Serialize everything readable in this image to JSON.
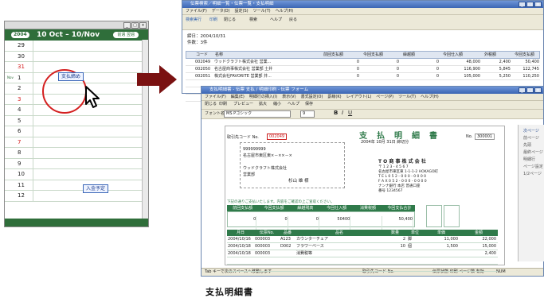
{
  "calendar": {
    "year_badge": "2004",
    "range": "10 Oct – 10/Nov",
    "nav_label": "前週 翌週",
    "rows": [
      {
        "num": "29",
        "sub": "",
        "red": false
      },
      {
        "num": "30",
        "sub": "",
        "red": false
      },
      {
        "num": "31",
        "sub": "",
        "red": true
      },
      {
        "num": "1",
        "sub": "Nov",
        "red": false
      },
      {
        "num": "2",
        "sub": "",
        "red": false
      },
      {
        "num": "3",
        "sub": "",
        "red": true
      },
      {
        "num": "4",
        "sub": "",
        "red": false
      },
      {
        "num": "5",
        "sub": "",
        "red": false
      },
      {
        "num": "6",
        "sub": "",
        "red": false
      },
      {
        "num": "7",
        "sub": "",
        "red": true
      },
      {
        "num": "8",
        "sub": "",
        "red": false
      },
      {
        "num": "9",
        "sub": "",
        "red": false
      },
      {
        "num": "10",
        "sub": "",
        "red": false
      },
      {
        "num": "11",
        "sub": "",
        "red": false
      },
      {
        "num": "12",
        "sub": "",
        "red": false
      }
    ],
    "event_payment": "支払締め",
    "event_deposit": "入金予定",
    "colors": {
      "header": "#2f6e3a",
      "highlight_circle": "#d42020"
    }
  },
  "list_window": {
    "title": "伝票検索／明細一覧・伝票一覧・支払明細",
    "menu": [
      "ファイル(F)",
      "データ(D)",
      "設定(S)",
      "ツール(T)",
      "ヘルプ(H)"
    ],
    "toolbar": [
      "検索実行",
      "印刷",
      "閉じる",
      "検索",
      "ヘルプ",
      "戻る"
    ],
    "date_label": "締日：2004/10/31",
    "count_label": "件数：3件",
    "headers": [
      "",
      "コード",
      "名称",
      "前回支払額",
      "今回支払額",
      "繰越額",
      "今回仕入額",
      "外税額",
      "今回支払額"
    ],
    "rows": [
      {
        "code": "002049",
        "name": "ウッドクラフト株式会社 営業...",
        "prev": "0",
        "paid": "0",
        "carry": "0",
        "purchase": "48,000",
        "tax": "2,400",
        "total": "50,400"
      },
      {
        "code": "002050",
        "name": "名古屋商事株式会社 営業部 土井",
        "prev": "0",
        "paid": "0",
        "carry": "0",
        "purchase": "116,900",
        "tax": "5,845",
        "total": "122,745"
      },
      {
        "code": "002051",
        "name": "株式会社FAVORITE 営業部 井...",
        "prev": "0",
        "paid": "0",
        "carry": "0",
        "purchase": "105,000",
        "tax": "5,250",
        "total": "110,250"
      }
    ]
  },
  "statement_window": {
    "title": "支払明細書 - 伝票 支払 / 明細印刷 - 伝票 フォーム",
    "menu": [
      "ファイル(F)",
      "編集(E)",
      "明細行の挿入(I)",
      "表示(V)",
      "書式設定(O)",
      "罫線(K)",
      "レイアウト(L)",
      "ページ(P)",
      "ツール(T)",
      "ヘルプ(H)"
    ],
    "toolbar": [
      "閉じる",
      "印刷",
      "プレビュー",
      "拡大",
      "縮小",
      "ヘルプ",
      "保存"
    ],
    "font_name": "MS Pゴシック",
    "font_size": "9",
    "doc_title": "支　払　明　細　書",
    "doc_no_label": "No.",
    "doc_no": "300001",
    "date_text": "2004年 10月 31日 締切分",
    "code_label": "取引先コード No.",
    "code_value": "002049",
    "postal": "999999999",
    "address": "名古屋市東区東×－××－×",
    "company_to": "ウッドクラフト株式会社",
    "dept_to": "営業部",
    "person_to": "杉山 雄 様",
    "issuer": {
      "name": "T O 商 事 株 式 会 社",
      "postal": "〒 1 2 3 - 4 5 6 7",
      "addr": "名古屋市東区東 1-1-1-2 HOKAGO町",
      "tel": "T E L  0 5 2 - 0 0 0 - 0 0 0 0",
      "fax": "F A X  0 5 2 - 0 0 0 - 0 0 0 0",
      "bank": "ナンナ銀行 本店 普通口座",
      "account": "番号 1234567"
    },
    "notice": "下記の通りご支払いたします。内容をご確認の上ご査収ください。",
    "summary_headers": [
      "前回支払額",
      "今回支払額",
      "繰越残高",
      "今回仕入額",
      "消費税額",
      "今回支払合計"
    ],
    "summary_values": [
      "0",
      "0",
      "0",
      "50400",
      "",
      "50,400"
    ],
    "detail_headers": [
      "月日",
      "伝票No.",
      "品番",
      "品名",
      "数量",
      "単位",
      "単価",
      "金額"
    ],
    "detail_rows": [
      {
        "date": "2004/10/16",
        "slip": "000003",
        "code": "A123",
        "name": "カウンターチェア",
        "qty": "2",
        "unit": "脚",
        "price": "11,000",
        "amount": "22,000"
      },
      {
        "date": "2004/10/18",
        "slip": "000003",
        "code": "D002",
        "name": "フラワーベース",
        "qty": "10",
        "unit": "個",
        "price": "1,500",
        "amount": "15,000"
      },
      {
        "date": "2004/10/18",
        "slip": "000003",
        "code": "",
        "name": "消費税等",
        "qty": "",
        "unit": "",
        "price": "",
        "amount": "2,400"
      }
    ],
    "side_items": [
      "次ページ",
      "前ページ",
      "先頭",
      "最終ページ",
      "明細行",
      "ページ設定",
      "1/2ページ"
    ],
    "status_left": "Tab キーで次のスペースへ移動します",
    "status_mid": "取引先コード No.",
    "status_right": "伝票状態 印刷 ページ数 有効",
    "status_num": "NUM"
  },
  "caption": "支払明細書"
}
